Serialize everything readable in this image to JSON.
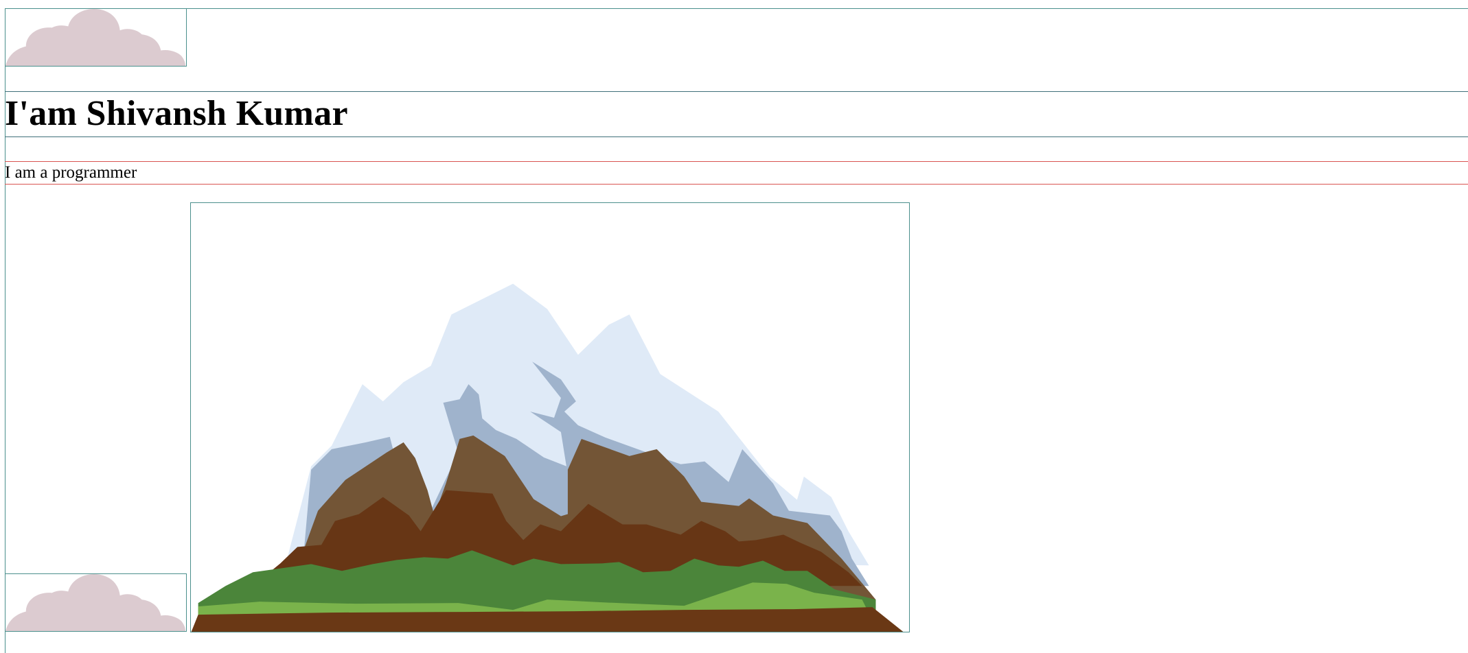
{
  "profile": {
    "heading": "I'am Shivansh Kumar",
    "tagline": "I am a programmer"
  },
  "images": {
    "cloud_top": "cloud-icon",
    "cloud_bottom": "cloud-icon",
    "mountain": "mountain-illustration"
  },
  "colors": {
    "cloud": "#dccbd0",
    "snow_light": "#dfeaf7",
    "snow_shadow": "#9fb3cc",
    "rock_light": "#735536",
    "rock_dark": "#673615",
    "grass_dark": "#4b853a",
    "grass_light": "#7ab34b",
    "soil": "#6a3815",
    "frame_border": "#4a8f8c",
    "title_border": "#3f6f7a",
    "tagline_border": "#d9534f"
  }
}
